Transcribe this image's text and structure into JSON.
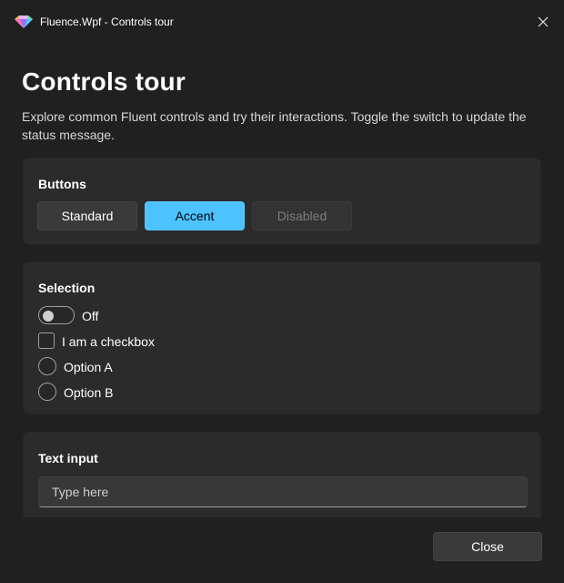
{
  "window": {
    "title": "Fluence.Wpf - Controls tour",
    "icon": "fluence-gem-icon",
    "close_icon": "close-icon"
  },
  "page": {
    "title": "Controls tour",
    "description": "Explore common Fluent controls and try their interactions. Toggle the switch to update the status message."
  },
  "buttons_card": {
    "title": "Buttons",
    "standard_label": "Standard",
    "accent_label": "Accent",
    "disabled_label": "Disabled"
  },
  "selection_card": {
    "title": "Selection",
    "toggle": {
      "label": "Off",
      "checked": false
    },
    "checkbox": {
      "label": "I am a checkbox",
      "checked": false
    },
    "radios": [
      {
        "label": "Option A",
        "selected": false
      },
      {
        "label": "Option B",
        "selected": false
      }
    ]
  },
  "text_card": {
    "title": "Text input",
    "value": "",
    "placeholder": "Type here"
  },
  "footer": {
    "close_label": "Close"
  },
  "colors": {
    "background": "#202020",
    "card": "#2b2b2b",
    "accent": "#4cc2ff"
  }
}
